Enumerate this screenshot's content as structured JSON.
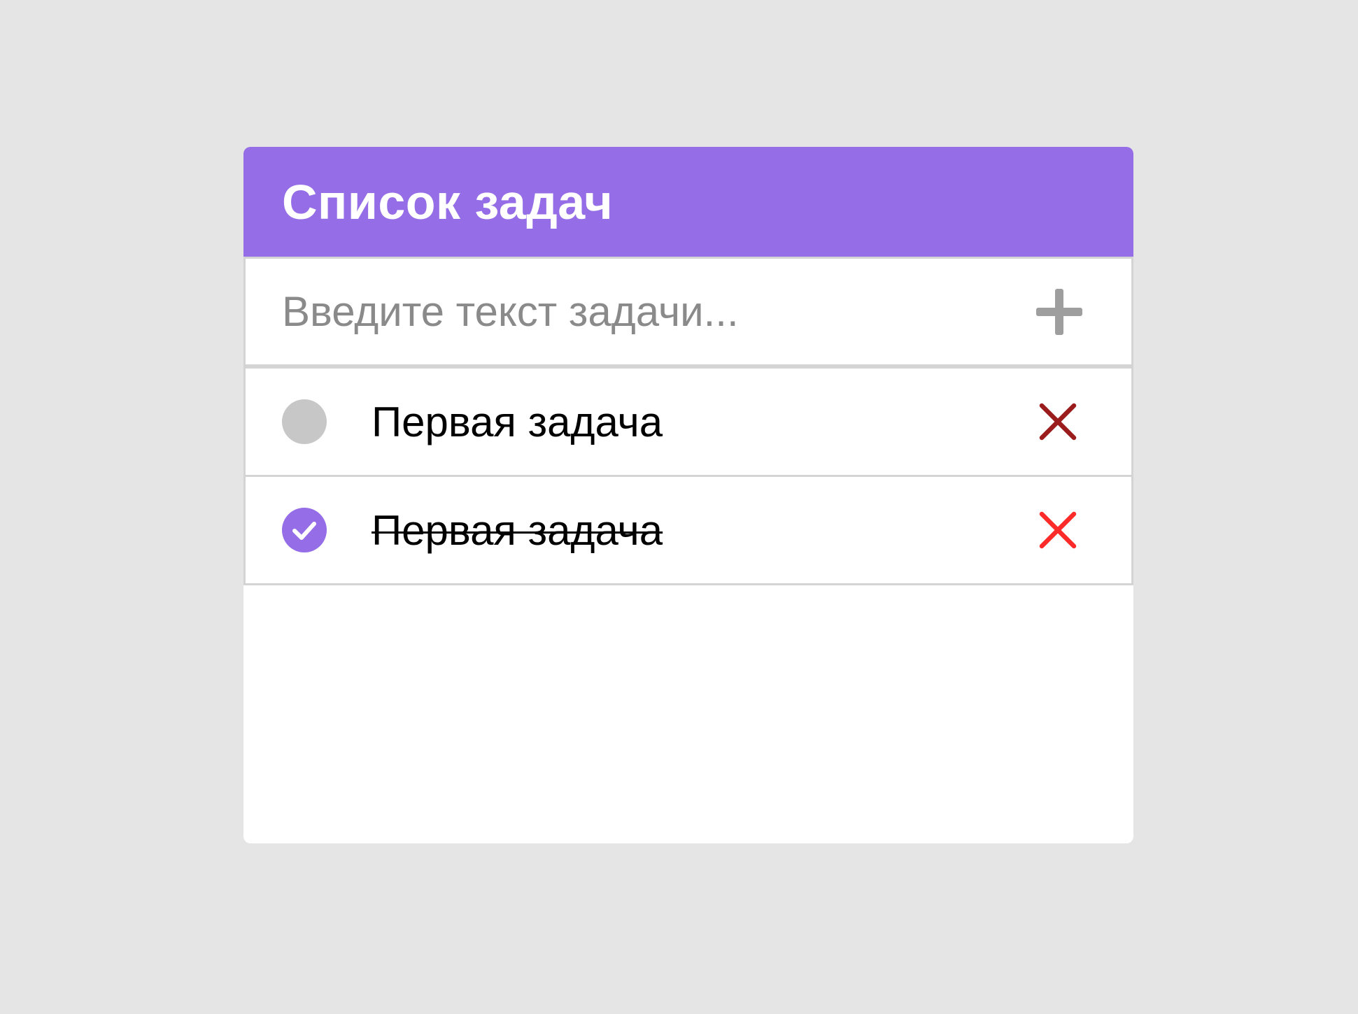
{
  "app": {
    "title": "Список задач"
  },
  "new_task": {
    "placeholder": "Введите текст задачи...",
    "value": ""
  },
  "tasks": [
    {
      "text": "Первая задача",
      "completed": false,
      "delete_color": "#9b1c1c"
    },
    {
      "text": "Первая задача",
      "completed": true,
      "delete_color": "#ff2a2a"
    }
  ],
  "colors": {
    "accent": "#956ee7",
    "background": "#e5e5e5",
    "card": "#ffffff",
    "border": "#d4d4d4",
    "checkbox_unchecked": "#c7c7c7",
    "add_icon": "#9e9e9e",
    "placeholder_text": "#8a8a8a"
  },
  "icons": {
    "add": "plus-icon",
    "delete": "close-icon",
    "check": "check-icon"
  }
}
